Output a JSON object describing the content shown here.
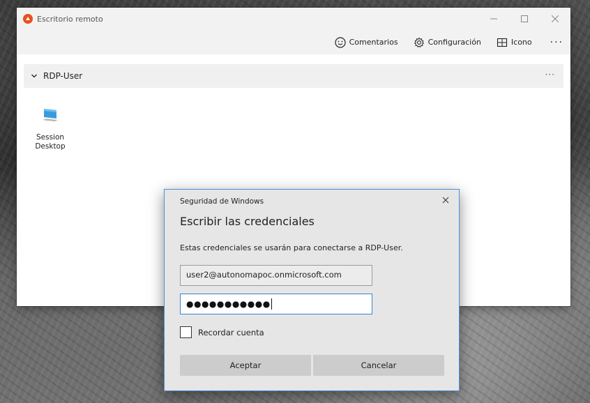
{
  "app": {
    "title": "Escritorio remoto",
    "brand_color": "#e8501f"
  },
  "toolbar": {
    "feedback_label": "Comentarios",
    "settings_label": "Configuración",
    "view_label": "Icono",
    "more_label": "···"
  },
  "group": {
    "title": "RDP-User",
    "more_label": "···"
  },
  "session": {
    "label": "SessionDesktop"
  },
  "dialog": {
    "caption": "Seguridad de Windows",
    "heading": "Escribir las credenciales",
    "message": "Estas credenciales se usarán para conectarse a RDP-User.",
    "username_value": "user2@autonomapoc.onmicrosoft.com",
    "password_masked": "●●●●●●●●●●●",
    "remember_label": "Recordar cuenta",
    "remember_checked": false,
    "ok_label": "Aceptar",
    "cancel_label": "Cancelar",
    "accent_color": "#3b82d6"
  }
}
